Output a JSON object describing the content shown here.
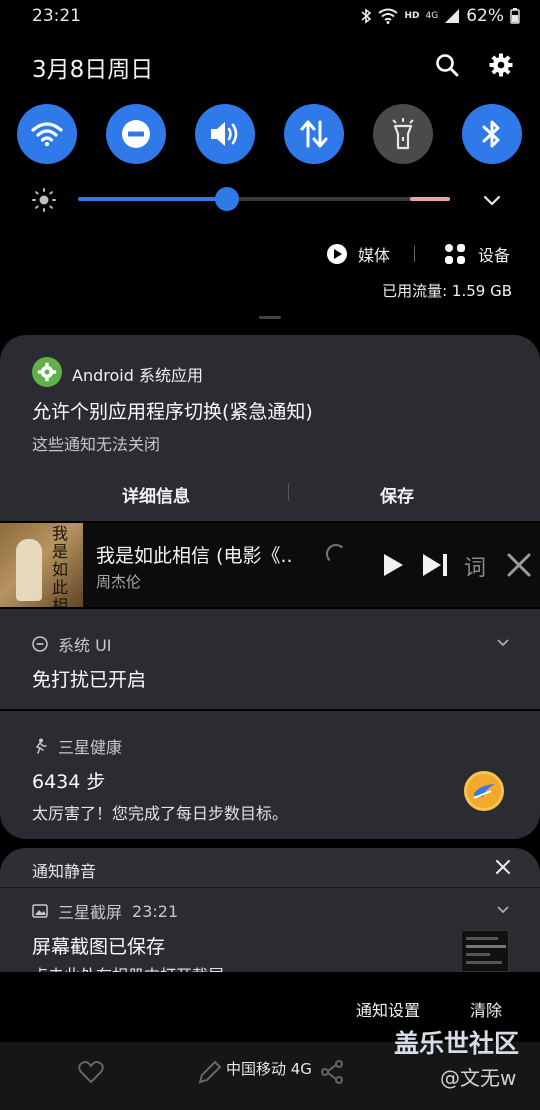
{
  "status_bar": {
    "time": "23:21",
    "network_hd": "HD",
    "network_4g": "4G",
    "battery": "62%"
  },
  "header": {
    "date": "3月8日周日"
  },
  "quick_settings": {
    "toggles": [
      "wifi-icon",
      "do-not-disturb-icon",
      "sound-icon",
      "mobile-data-icon",
      "flashlight-icon",
      "bluetooth-icon"
    ],
    "brightness_level": 0.4,
    "media_label": "媒体",
    "device_label": "设备",
    "data_usage": "已用流量: 1.59 GB"
  },
  "notification_android": {
    "app": "Android 系统应用",
    "title": "允许个别应用程序切换(紧急通知)",
    "text": "这些通知无法关闭",
    "action_details": "详细信息",
    "action_save": "保存"
  },
  "media_player": {
    "album_text": "我是如此相信",
    "title": "我是如此相信 (电影《..",
    "artist": "周杰伦",
    "lyrics_label": "词"
  },
  "notification_system_ui": {
    "app": "系统 UI",
    "title": "免打扰已开启"
  },
  "notification_health": {
    "app": "三星健康",
    "steps": "6434 步",
    "text": "太厉害了！您完成了每日步数目标。"
  },
  "silent_section": {
    "title": "通知静音",
    "screenshot_app": "三星截屏",
    "screenshot_time": "23:21",
    "screenshot_title": "屏幕截图已保存",
    "screenshot_text": "点击此处在相册中打开截屏"
  },
  "footer": {
    "notification_settings": "通知设置",
    "clear": "清除",
    "carrier": "中国移动 4G",
    "watermark_site": "盖乐世社区",
    "watermark_user": "@文无w"
  },
  "colors": {
    "accent": "#2f7ae8",
    "card": "#2a2c31",
    "health_medal": "#f2a92c"
  }
}
